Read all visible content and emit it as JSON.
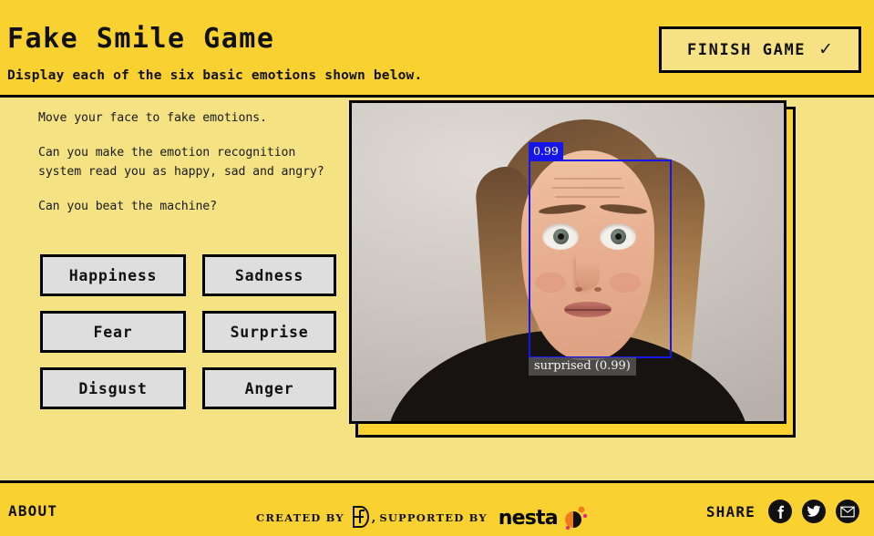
{
  "header": {
    "title": "Fake Smile Game",
    "subtitle": "Display each of the six basic emotions shown below.",
    "finish_button": {
      "label": "FINISH GAME",
      "check_glyph": "✓"
    },
    "background_color": "#F9D130"
  },
  "main": {
    "background_color": "#F4E283",
    "instructions": [
      "Move your face to fake emotions.",
      "Can you make the emotion recognition system read you as happy, sad and angry?",
      "Can you beat the machine?"
    ],
    "emotions": [
      {
        "label": "Happiness"
      },
      {
        "label": "Sadness"
      },
      {
        "label": "Fear"
      },
      {
        "label": "Surprise"
      },
      {
        "label": "Disgust"
      },
      {
        "label": "Anger"
      }
    ],
    "emotion_button_fill": "#DEDEDE",
    "video": {
      "detection": {
        "score_badge": "0.99",
        "label": "surprised (0.99)",
        "box_color": "#1616E8",
        "label_background": "rgba(90,90,90,0.78)"
      }
    }
  },
  "footer": {
    "about_label": "ABOUT",
    "created_by_label": "CREATED BY",
    "supported_by_label": "SUPPORTED BY",
    "comma": ",",
    "partner_logo_name": "nesta",
    "share_label": "SHARE",
    "social": [
      {
        "name": "facebook"
      },
      {
        "name": "twitter"
      },
      {
        "name": "email"
      }
    ],
    "background_color": "#F9D130",
    "accent_orange": "#F07D1A",
    "accent_pink": "#E8267C"
  }
}
